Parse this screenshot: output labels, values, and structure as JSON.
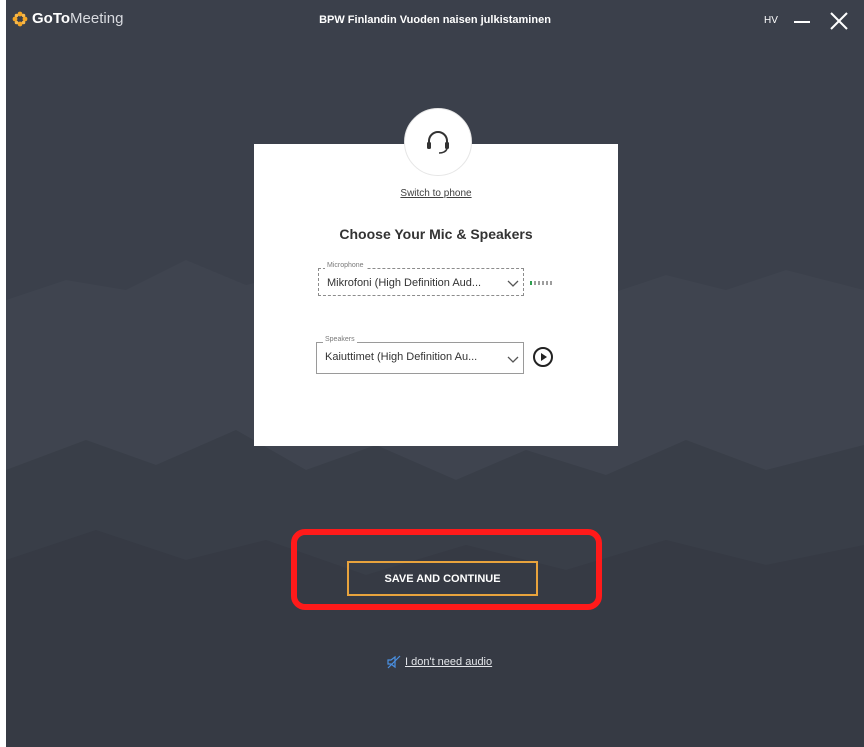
{
  "app": {
    "logo_bold": "GoTo",
    "logo_light": "Meeting",
    "window_title": "BPW Finlandin Vuoden naisen julkistaminen",
    "user_initials": "HV"
  },
  "audio_setup": {
    "switch_to_phone": "Switch to phone",
    "heading": "Choose Your Mic & Speakers",
    "microphone": {
      "label": "Microphone",
      "value": "Mikrofoni (High Definition Aud..."
    },
    "speakers": {
      "label": "Speakers",
      "value": "Kaiuttimet (High Definition Au..."
    }
  },
  "actions": {
    "save_and_continue": "SAVE AND CONTINUE",
    "no_audio": "I don't need audio"
  },
  "colors": {
    "background": "#3b404b",
    "accent_orange": "#e8a33d",
    "annotation_red": "#ff1a1a",
    "logo_orange": "#f5a623"
  },
  "icons": [
    "logo-icon",
    "minimize-icon",
    "close-icon",
    "headset-icon",
    "chevron-down-icon",
    "mic-level-icon",
    "play-icon",
    "speaker-muted-icon"
  ]
}
